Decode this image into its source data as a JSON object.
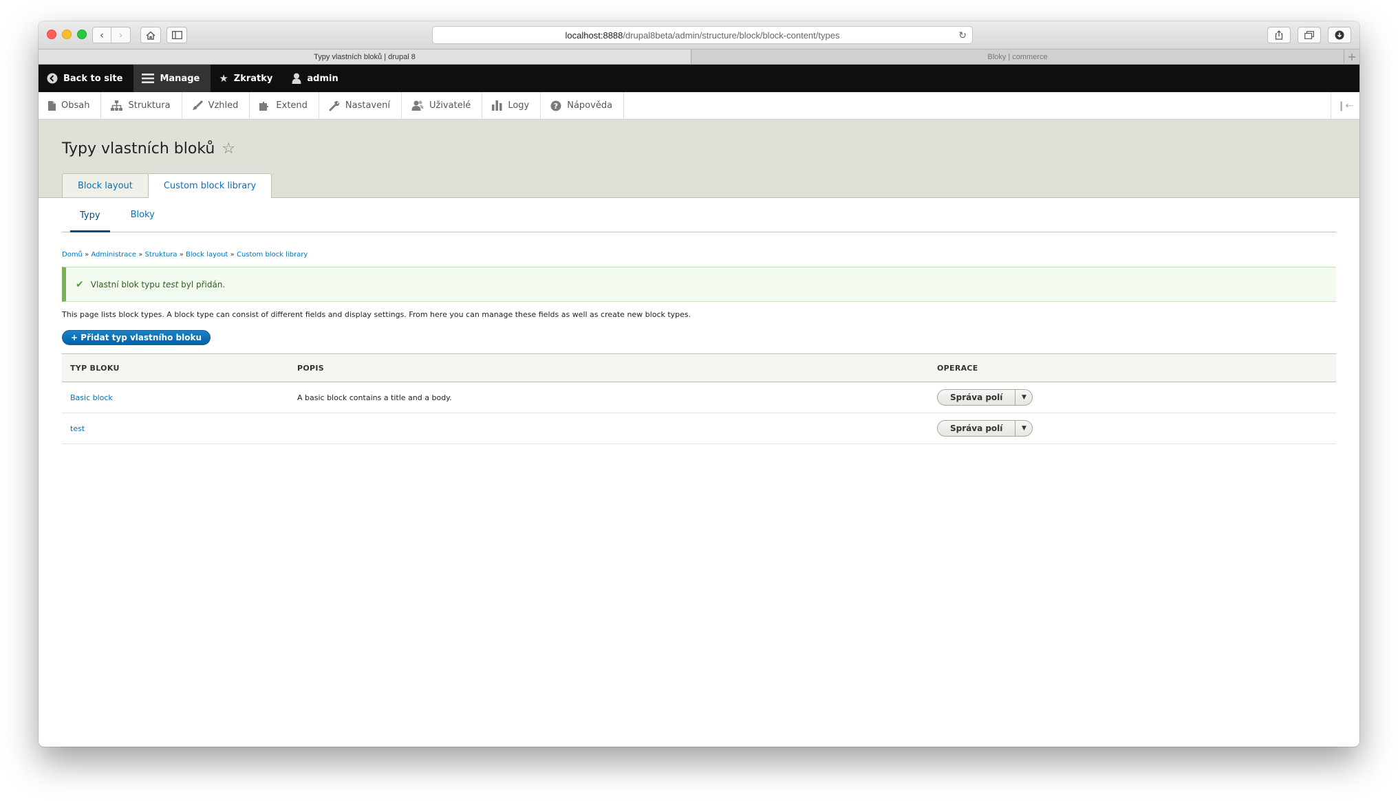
{
  "browser": {
    "url_host": "localhost:8888",
    "url_path": "/drupal8beta/admin/structure/block/block-content/types",
    "tabs": [
      {
        "label": "Typy vlastních bloků | drupal 8"
      },
      {
        "label": "Bloky | commerce"
      }
    ]
  },
  "toolbar": {
    "back_to_site": "Back to site",
    "manage": "Manage",
    "shortcuts": "Zkratky",
    "user": "admin"
  },
  "tray": {
    "items": [
      {
        "label": "Obsah",
        "icon": "file-icon"
      },
      {
        "label": "Struktura",
        "icon": "sitemap-icon"
      },
      {
        "label": "Vzhled",
        "icon": "paintbrush-icon"
      },
      {
        "label": "Extend",
        "icon": "puzzle-icon"
      },
      {
        "label": "Nastavení",
        "icon": "wrench-icon"
      },
      {
        "label": "Uživatelé",
        "icon": "users-icon"
      },
      {
        "label": "Logy",
        "icon": "bar-chart-icon"
      },
      {
        "label": "Nápověda",
        "icon": "help-icon"
      }
    ]
  },
  "page": {
    "title": "Typy vlastních bloků",
    "primary_tabs": [
      {
        "label": "Block layout"
      },
      {
        "label": "Custom block library"
      }
    ],
    "secondary_tabs": [
      {
        "label": "Typy"
      },
      {
        "label": "Bloky"
      }
    ],
    "breadcrumb": [
      {
        "label": "Domů"
      },
      {
        "label": "Administrace"
      },
      {
        "label": "Struktura"
      },
      {
        "label": "Block layout"
      },
      {
        "label": "Custom block library"
      }
    ],
    "message": {
      "before": "Vlastní blok typu ",
      "emphasis": "test",
      "after": " byl přidán."
    },
    "description": "This page lists block types. A block type can consist of different fields and display settings. From here you can manage these fields as well as create new block types.",
    "add_button": "+ Přidat typ vlastního bloku"
  },
  "table": {
    "headers": [
      "TYP BLOKU",
      "POPIS",
      "OPERACE"
    ],
    "rows": [
      {
        "name": "Basic block",
        "description": "A basic block contains a title and a body.",
        "operation": "Správa polí"
      },
      {
        "name": "test",
        "description": "",
        "operation": "Správa polí"
      }
    ]
  }
}
